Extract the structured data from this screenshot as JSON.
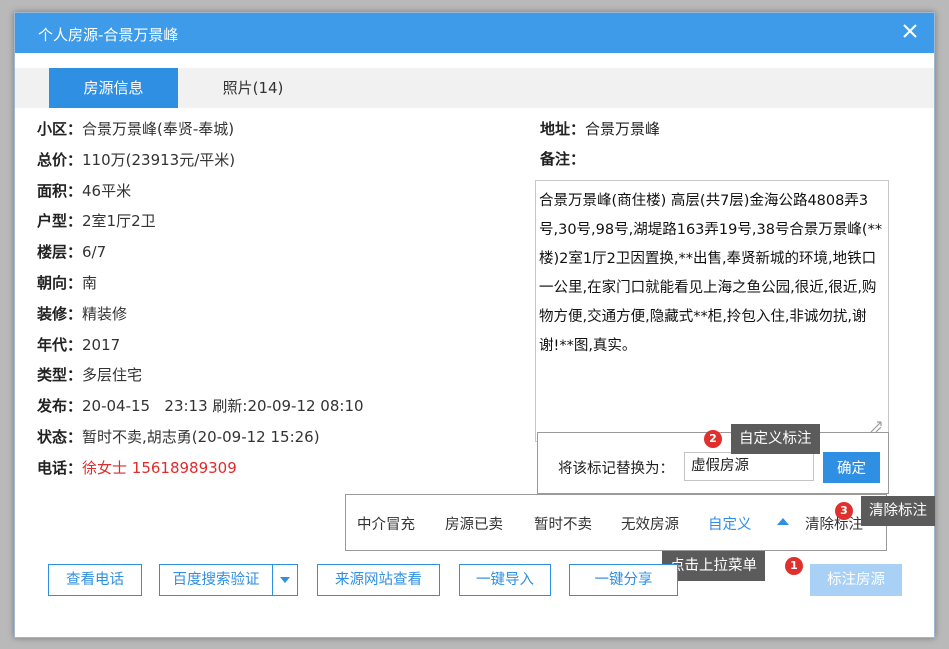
{
  "window": {
    "title": "个人房源-合景万景峰"
  },
  "tabs": [
    {
      "label": "房源信息"
    },
    {
      "label": "照片(14)"
    }
  ],
  "info": [
    {
      "label": "小区：",
      "value": "合景万景峰(奉贤-奉城)"
    },
    {
      "label": "总价：",
      "value": "110万(23913元/平米)"
    },
    {
      "label": "面积：",
      "value": "46平米"
    },
    {
      "label": "户型：",
      "value": "2室1厅2卫"
    },
    {
      "label": "楼层：",
      "value": "6/7"
    },
    {
      "label": "朝向：",
      "value": "南"
    },
    {
      "label": "装修：",
      "value": "精装修"
    },
    {
      "label": "年代：",
      "value": "2017"
    },
    {
      "label": "类型：",
      "value": "多层住宅"
    },
    {
      "label": "发布：",
      "value": "20-04-15   23:13 刷新:20-09-12 08:10"
    },
    {
      "label": "状态：",
      "value": "暂时不卖,胡志勇(20-09-12 15:26)"
    },
    {
      "label": "电话：",
      "value": "徐女士 15618989309"
    }
  ],
  "address": {
    "label": "地址：",
    "value": "合景万景峰"
  },
  "remark": {
    "label": "备注："
  },
  "notes": "合景万景峰(商住楼) 高层(共7层)金海公路4808弄3号,30号,98号,湖堤路163弄19号,38号合景万景峰(**楼)2室1厅2卫因置换,**出售,奉贤新城的环境,地铁口一公里,在家门口就能看见上海之鱼公园,很近,很近,购物方便,交通方便,隐藏式**柜,拎包入住,非诚勿扰,谢谢!**图,真实。",
  "replace": {
    "label": "将该标记替换为：",
    "input_value": "虚假房源",
    "confirm": "确定"
  },
  "menu": {
    "items": [
      "中介冒充",
      "房源已卖",
      "暂时不卖",
      "无效房源",
      "自定义",
      "清除标注"
    ]
  },
  "callouts": [
    {
      "badge": "1",
      "text": "点击上拉菜单"
    },
    {
      "badge": "2",
      "text": "自定义标注"
    },
    {
      "badge": "3",
      "text": "清除标注"
    }
  ],
  "buttons": {
    "view_phone": "查看电话",
    "baidu_verify": "百度搜索验证",
    "source_site": "来源网站查看",
    "import": "一键导入",
    "share": "一键分享",
    "mark": "标注房源"
  },
  "colors": {
    "accent": "#2f8fe3",
    "titlebar": "#3d9be9",
    "phone": "#e02b2b",
    "badge": "#e0302d"
  }
}
